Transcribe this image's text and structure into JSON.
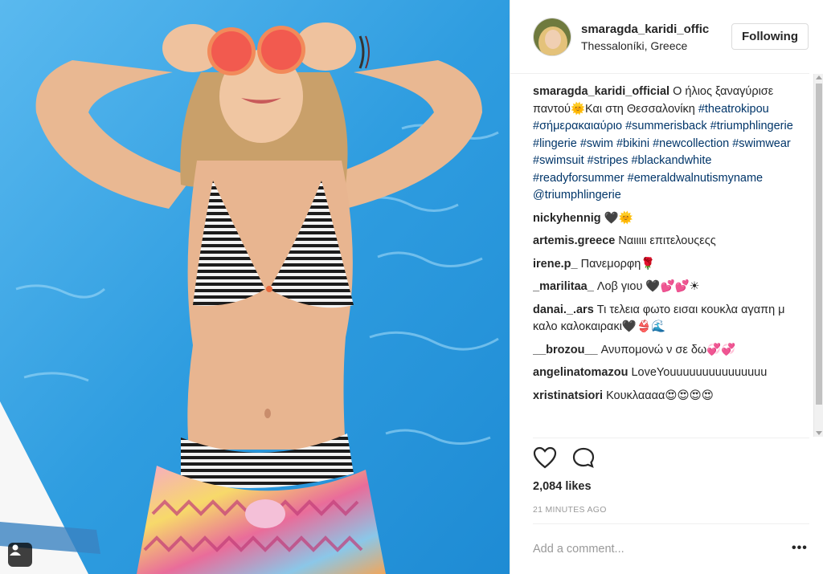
{
  "post": {
    "username": "smaragda_karidi_offic",
    "location": "Thessaloníki, Greece",
    "follow_label": "Following",
    "caption": {
      "user": "smaragda_karidi_official",
      "text_part1": "Ο ήλιος ξαναγύρισε παντού🌞Και στη Θεσσαλονίκη ",
      "hashtags": "#theatrokipou #σήμερακαιαύριο #summerisback #triumphlingerie #lingerie #swim #bikini #newcollection #swimwear #swimsuit #stripes #blackandwhite #readyforsummer #emeraldwalnutismyname @triumphlingerie"
    },
    "comments": [
      {
        "user": "nickyhennig",
        "text": "🖤🌞"
      },
      {
        "user": "artemis.greece",
        "text": "Ναιιιιι επιτελουςεςς"
      },
      {
        "user": "irene.p_",
        "text": "Πανεμορφη🌹"
      },
      {
        "user": "_marilitaa_",
        "text": "Λοβ γιου 🖤💕💕☀"
      },
      {
        "user": "danai._.ars",
        "text": "Τι τελεια φωτο εισαι κουκλα αγαπη μ καλο καλοκαιρακι🖤👙🌊"
      },
      {
        "user": "__brozou__",
        "text": "Ανυπομονώ ν σε δω💞💞"
      },
      {
        "user": "angelinatomazou",
        "text": "LoveYouuuuuuuuuuuuuuu"
      },
      {
        "user": "xristinatsiori",
        "text": "Κουκλαααα😍😍😍😍"
      }
    ],
    "likes": "2,084 likes",
    "time": "21 MINUTES AGO",
    "comment_placeholder": "Add a comment...",
    "more_label": "•••"
  },
  "icons": {
    "like": "heart-icon",
    "comment": "comment-bubble-icon",
    "tag": "person-tag-icon",
    "more": "ellipsis-icon"
  },
  "colors": {
    "hashtag": "#003569",
    "pool_blue": "#3fa7e6",
    "text": "#262626",
    "muted": "#999999"
  }
}
